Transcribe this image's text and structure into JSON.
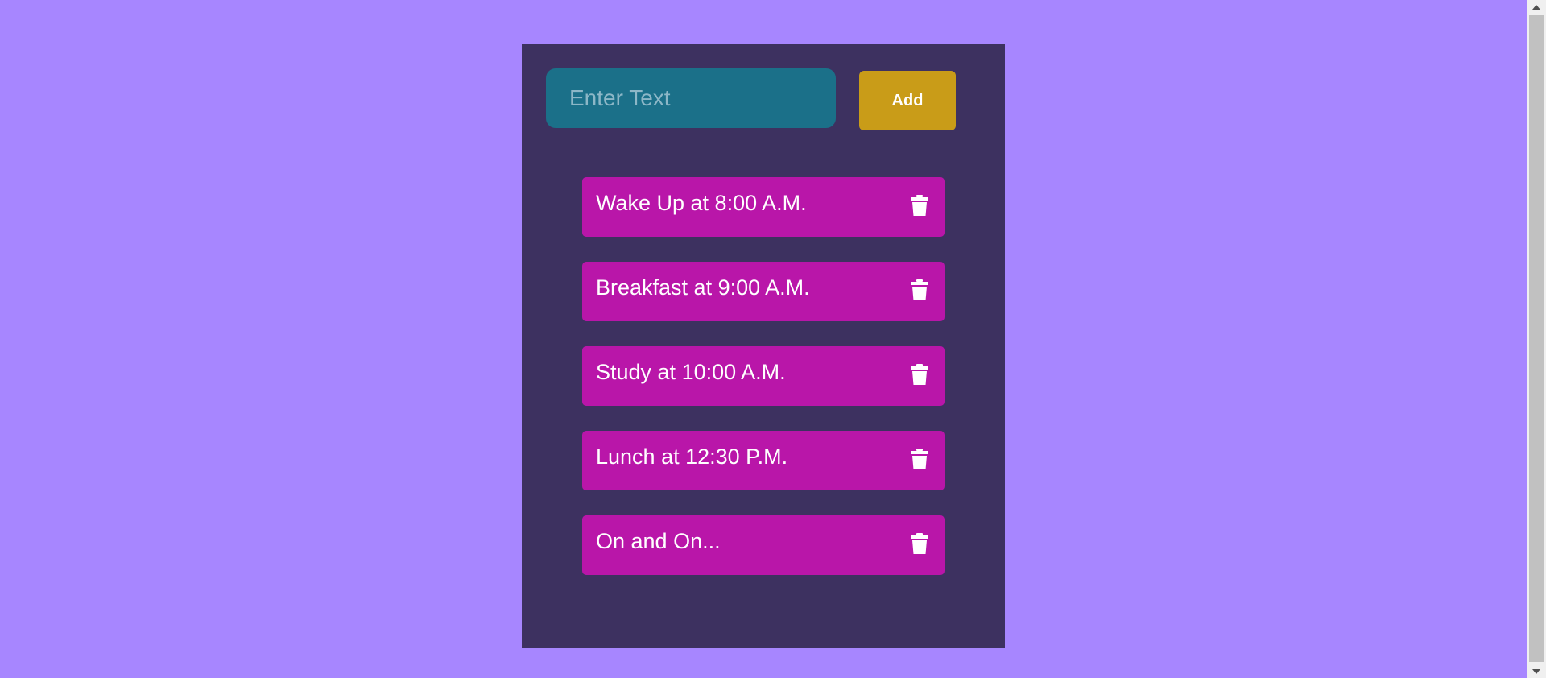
{
  "input": {
    "placeholder": "Enter Text",
    "value": ""
  },
  "add_button": {
    "label": "Add"
  },
  "tasks": [
    {
      "text": "Wake Up at 8:00 A.M.",
      "icon": "trash-icon"
    },
    {
      "text": "Breakfast at 9:00 A.M.",
      "icon": "trash-icon"
    },
    {
      "text": "Study at 10:00 A.M.",
      "icon": "trash-icon"
    },
    {
      "text": "Lunch at 12:30 P.M.",
      "icon": "trash-icon"
    },
    {
      "text": "On and On...",
      "icon": "trash-icon"
    }
  ],
  "colors": {
    "page_background": "#a786ff",
    "panel_background": "#3d3160",
    "input_background": "#1b7089",
    "input_placeholder": "#8cb7c7",
    "add_button": "#c99c18",
    "task_background": "#b916a9",
    "task_text": "#ffffff"
  }
}
